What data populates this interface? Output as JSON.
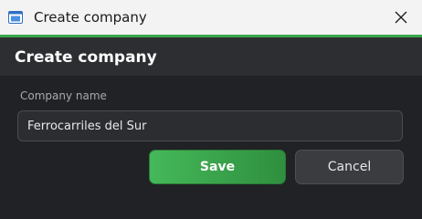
{
  "window": {
    "title": "Create company",
    "close_icon": "close-icon",
    "app_icon": "window-app-icon"
  },
  "dialog": {
    "title": "Create company",
    "company_name_label": "Company name",
    "company_name_value": "Ferrocarriles del Sur",
    "save_label": "Save",
    "cancel_label": "Cancel"
  },
  "colors": {
    "accent": "#3aa64a",
    "save_button": "#3fae52",
    "background": "#202225",
    "titlebar": "#f3f3f3"
  }
}
